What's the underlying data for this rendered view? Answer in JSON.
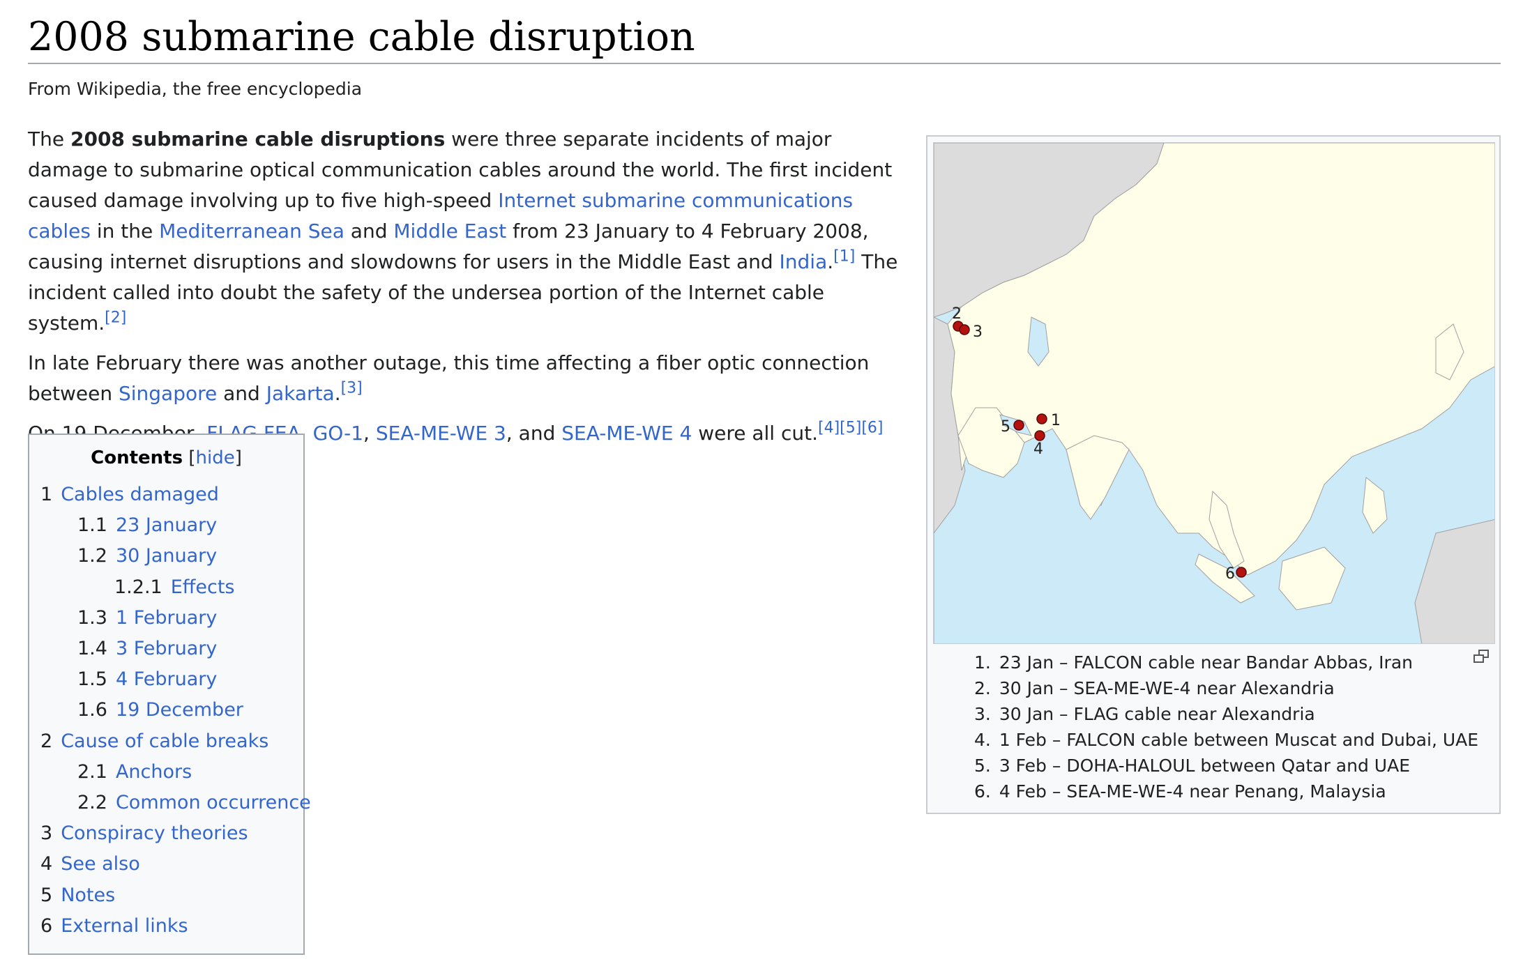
{
  "article": {
    "title": "2008 submarine cable disruption",
    "tagline": "From Wikipedia, the free encyclopedia"
  },
  "intro": {
    "p1": {
      "t1": "The ",
      "bold": "2008 submarine cable disruptions",
      "t2": " were three separate incidents of major damage to submarine optical communication cables around the world. The first incident caused damage involving up to five high-speed ",
      "link1": "Internet submarine communications cables",
      "t3": " in the ",
      "link2": "Mediterranean Sea",
      "t4": " and ",
      "link3": "Middle East",
      "t5": " from 23 January to 4 February 2008, causing internet disruptions and slowdowns for users in the Middle East and ",
      "link4": "India",
      "t6": ".",
      "ref1": "[1]",
      "t7": " The incident called into doubt the safety of the undersea portion of the Internet cable system.",
      "ref2": "[2]"
    },
    "p2": {
      "t1": "In late February there was another outage, this time affecting a fiber optic connection between ",
      "link1": "Singapore",
      "t2": " and ",
      "link2": "Jakarta",
      "t3": ".",
      "ref1": "[3]"
    },
    "p3": {
      "t1": "On 19 December, ",
      "link1": "FLAG FEA",
      "sep1": ", ",
      "link2": "GO-1",
      "sep2": ", ",
      "link3": "SEA-ME-WE 3",
      "t2": ", and ",
      "link4": "SEA-ME-WE 4",
      "t3": " were all cut.",
      "ref1": "[4]",
      "ref2": "[5]",
      "ref3": "[6]"
    }
  },
  "toc": {
    "title": "Contents",
    "toggle_open": "[",
    "toggle": "hide",
    "toggle_close": "]",
    "items": [
      {
        "num": "1",
        "label": "Cables damaged"
      },
      {
        "num": "1.1",
        "label": "23 January"
      },
      {
        "num": "1.2",
        "label": "30 January"
      },
      {
        "num": "1.2.1",
        "label": "Effects"
      },
      {
        "num": "1.3",
        "label": "1 February"
      },
      {
        "num": "1.4",
        "label": "3 February"
      },
      {
        "num": "1.5",
        "label": "4 February"
      },
      {
        "num": "1.6",
        "label": "19 December"
      },
      {
        "num": "2",
        "label": "Cause of cable breaks"
      },
      {
        "num": "2.1",
        "label": "Anchors"
      },
      {
        "num": "2.2",
        "label": "Common occurrence"
      },
      {
        "num": "3",
        "label": "Conspiracy theories"
      },
      {
        "num": "4",
        "label": "See also"
      },
      {
        "num": "5",
        "label": "Notes"
      },
      {
        "num": "6",
        "label": "External links"
      }
    ]
  },
  "map": {
    "markers": [
      {
        "label": "1"
      },
      {
        "label": "2"
      },
      {
        "label": "3"
      },
      {
        "label": "4"
      },
      {
        "label": "5"
      },
      {
        "label": "6"
      }
    ],
    "colors": {
      "ocean": "#cdeaf9",
      "land": "#fefee9",
      "other_land": "#dcdcdc",
      "marker": "#b3120f"
    }
  },
  "caption": {
    "items": [
      {
        "num": "1.",
        "text": "23 Jan – FALCON cable near Bandar Abbas, Iran"
      },
      {
        "num": "2.",
        "text": "30 Jan – SEA-ME-WE-4 near Alexandria"
      },
      {
        "num": "3.",
        "text": "30 Jan – FLAG cable near Alexandria"
      },
      {
        "num": "4.",
        "text": "1 Feb – FALCON cable between Muscat and Dubai, UAE"
      },
      {
        "num": "5.",
        "text": "3 Feb – DOHA-HALOUL between Qatar and UAE"
      },
      {
        "num": "6.",
        "text": "4 Feb – SEA-ME-WE-4 near Penang, Malaysia"
      }
    ]
  }
}
